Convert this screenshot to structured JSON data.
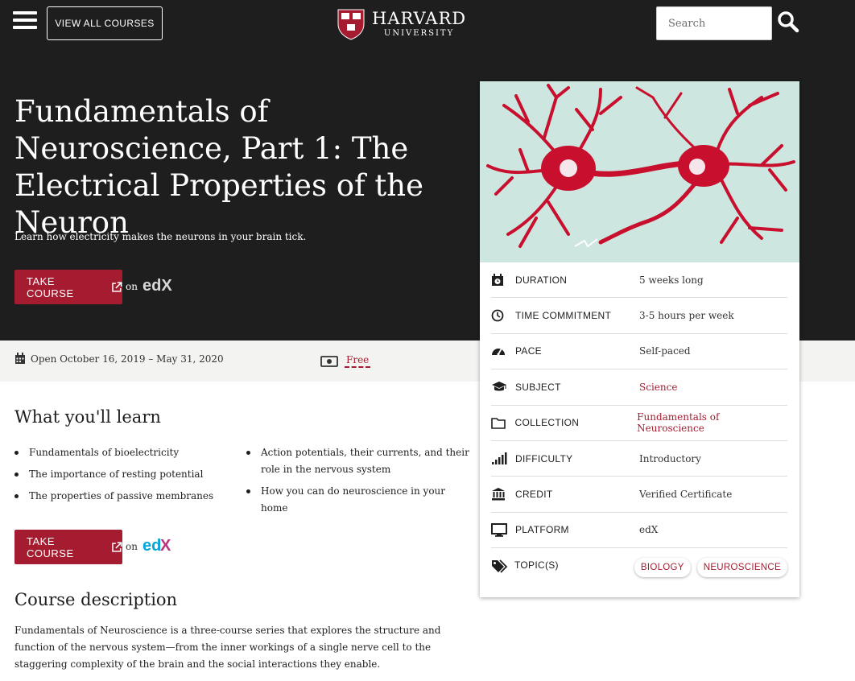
{
  "header": {
    "view_all_label": "VIEW ALL COURSES",
    "logo_word": "HARVARD",
    "logo_sub": "UNIVERSITY",
    "search_placeholder": "Search",
    "menu_icon": "hamburger-icon",
    "search_icon": "search-icon"
  },
  "hero": {
    "title": "Fundamentals of Neuroscience, Part 1: The Electrical Properties of the Neuron",
    "subtitle": "Learn how electricity makes the neurons in your brain tick."
  },
  "cta": {
    "take_course_label": "TAKE COURSE",
    "on_label": "on",
    "platform_logo": "edX"
  },
  "info_bar": {
    "open_dates": "Open October 16, 2019 – May 31, 2020",
    "price": "Free"
  },
  "learn": {
    "heading": "What you'll learn",
    "col1": [
      "Fundamentals of bioelectricity",
      "The importance of resting potential",
      "The properties of passive membranes"
    ],
    "col2": [
      "Action potentials, their currents, and their role in the nervous system",
      "How you can do neuroscience in your home"
    ]
  },
  "description": {
    "heading": "Course description",
    "text": "Fundamentals of Neuroscience is a three-course series that explores the structure and function of the nervous system—from the inner workings of a single nerve cell to the staggering complexity of the brain and the social interactions they enable."
  },
  "facts": [
    {
      "icon": "calendar-clock-icon",
      "label": "DURATION",
      "value": "5 weeks long",
      "link": false
    },
    {
      "icon": "clock-icon",
      "label": "TIME COMMITMENT",
      "value": "3-5 hours per week",
      "link": false
    },
    {
      "icon": "gauge-icon",
      "label": "PACE",
      "value": "Self-paced",
      "link": false
    },
    {
      "icon": "graduation-cap-icon",
      "label": "SUBJECT",
      "value": "Science",
      "link": true
    },
    {
      "icon": "folder-icon",
      "label": "COLLECTION",
      "value": "Fundamentals of Neuroscience",
      "link": true
    },
    {
      "icon": "signal-bars-icon",
      "label": "DIFFICULTY",
      "value": "Introductory",
      "link": false
    },
    {
      "icon": "institution-icon",
      "label": "CREDIT",
      "value": "Verified Certificate",
      "link": false
    },
    {
      "icon": "monitor-icon",
      "label": "PLATFORM",
      "value": "edX",
      "link": false
    },
    {
      "icon": "tags-icon",
      "label": "TOPIC(S)",
      "tags": [
        "BIOLOGY",
        "NEUROSCIENCE"
      ]
    }
  ],
  "colors": {
    "crimson": "#a51c30",
    "hero_bg": "#1e1e1e",
    "info_bar_bg": "#f3f3f1",
    "image_bg": "#cde6df"
  }
}
